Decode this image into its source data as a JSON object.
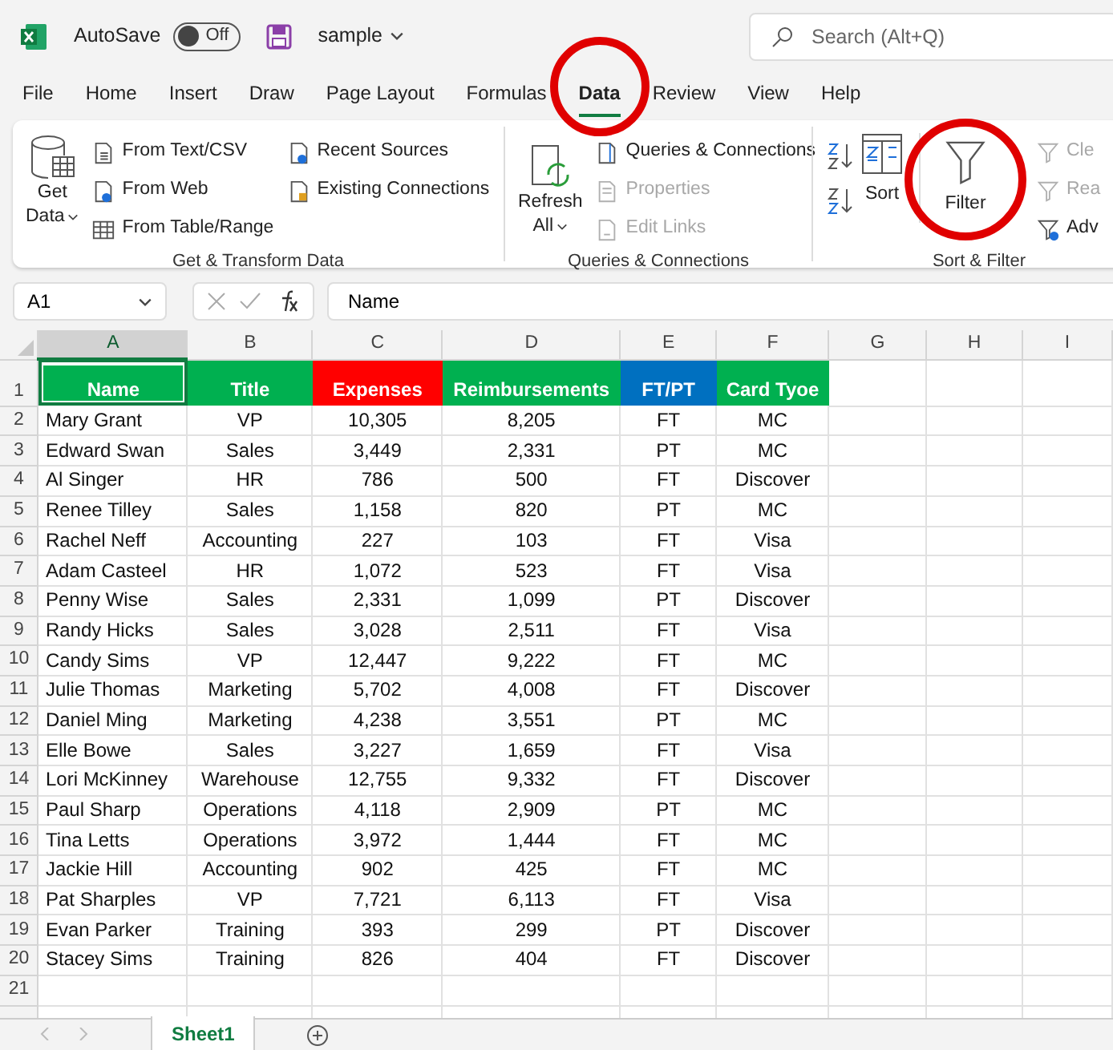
{
  "title_bar": {
    "autosave_label": "AutoSave",
    "autosave": {
      "on": false,
      "label": "Off"
    },
    "filename": "sample",
    "search": {
      "placeholder": "Search (Alt+Q)"
    }
  },
  "menu_tabs": [
    {
      "label": "File",
      "selected": false
    },
    {
      "label": "Home",
      "selected": false
    },
    {
      "label": "Insert",
      "selected": false
    },
    {
      "label": "Draw",
      "selected": false
    },
    {
      "label": "Page Layout",
      "selected": false
    },
    {
      "label": "Formulas",
      "selected": false
    },
    {
      "label": "Data",
      "selected": true
    },
    {
      "label": "Review",
      "selected": false
    },
    {
      "label": "View",
      "selected": false
    },
    {
      "label": "Help",
      "selected": false
    }
  ],
  "ribbon": {
    "groups": [
      {
        "label": "Get & Transform Data",
        "large": {
          "lines": [
            "Get",
            "Data"
          ],
          "kind": "database"
        },
        "columns": [
          [
            {
              "label": "From Text/CSV",
              "kind": "text",
              "disabled": false
            },
            {
              "label": "From Web",
              "kind": "web",
              "disabled": false
            },
            {
              "label": "From Table/Range",
              "kind": "table",
              "disabled": false
            }
          ],
          [
            {
              "label": "Recent Sources",
              "kind": "recent",
              "disabled": false
            },
            {
              "label": "Existing Connections",
              "kind": "connection",
              "disabled": false
            }
          ]
        ]
      },
      {
        "label": "Queries & Connections",
        "large": {
          "lines": [
            "Refresh",
            "All"
          ],
          "kind": "refresh"
        },
        "columns": [
          [
            {
              "label": "Queries & Connections",
              "kind": "queries",
              "disabled": false
            },
            {
              "label": "Properties",
              "kind": "properties",
              "disabled": true
            },
            {
              "label": "Edit Links",
              "kind": "links",
              "disabled": true
            }
          ]
        ]
      },
      {
        "label": "Sort & Filter",
        "sort": {
          "label": "Sort"
        },
        "filter": {
          "label": "Filter"
        },
        "columns": [
          [
            {
              "label": "Cle",
              "kind": "clear",
              "disabled": true
            },
            {
              "label": "Rea",
              "kind": "reapply",
              "disabled": true
            },
            {
              "label": "Adv",
              "kind": "advanced",
              "disabled": false
            }
          ]
        ]
      }
    ]
  },
  "formula_bar": {
    "name_box": "A1",
    "formula": "Name"
  },
  "sheet": {
    "columns": [
      {
        "label": "A",
        "selected": true
      },
      {
        "label": "B",
        "selected": false
      },
      {
        "label": "C",
        "selected": false
      },
      {
        "label": "D",
        "selected": false
      },
      {
        "label": "E",
        "selected": false
      },
      {
        "label": "F",
        "selected": false
      },
      {
        "label": "G",
        "selected": false
      },
      {
        "label": "H",
        "selected": false
      },
      {
        "label": "I",
        "selected": false
      }
    ],
    "header": [
      {
        "text": "Name",
        "color": "#00b050"
      },
      {
        "text": "Title",
        "color": "#00b050"
      },
      {
        "text": "Expenses",
        "color": "#ff0000"
      },
      {
        "text": "Reimbursements",
        "color": "#00b050"
      },
      {
        "text": "FT/PT",
        "color": "#0070c0"
      },
      {
        "text": "Card Tyoe",
        "color": "#00b050"
      }
    ],
    "rows": [
      [
        "Mary Grant",
        "VP",
        "10,305",
        "8,205",
        "FT",
        "MC"
      ],
      [
        "Edward Swan",
        "Sales",
        "3,449",
        "2,331",
        "PT",
        "MC"
      ],
      [
        "Al Singer",
        "HR",
        "786",
        "500",
        "FT",
        "Discover"
      ],
      [
        "Renee Tilley",
        "Sales",
        "1,158",
        "820",
        "PT",
        "MC"
      ],
      [
        "Rachel Neff",
        "Accounting",
        "227",
        "103",
        "FT",
        "Visa"
      ],
      [
        "Adam Casteel",
        "HR",
        "1,072",
        "523",
        "FT",
        "Visa"
      ],
      [
        "Penny Wise",
        "Sales",
        "2,331",
        "1,099",
        "PT",
        "Discover"
      ],
      [
        "Randy Hicks",
        "Sales",
        "3,028",
        "2,511",
        "FT",
        "Visa"
      ],
      [
        "Candy Sims",
        "VP",
        "12,447",
        "9,222",
        "FT",
        "MC"
      ],
      [
        "Julie Thomas",
        "Marketing",
        "5,702",
        "4,008",
        "FT",
        "Discover"
      ],
      [
        "Daniel Ming",
        "Marketing",
        "4,238",
        "3,551",
        "PT",
        "MC"
      ],
      [
        "Elle Bowe",
        "Sales",
        "3,227",
        "1,659",
        "FT",
        "Visa"
      ],
      [
        "Lori McKinney",
        "Warehouse",
        "12,755",
        "9,332",
        "FT",
        "Discover"
      ],
      [
        "Paul Sharp",
        "Operations",
        "4,118",
        "2,909",
        "PT",
        "MC"
      ],
      [
        "Tina Letts",
        "Operations",
        "3,972",
        "1,444",
        "FT",
        "MC"
      ],
      [
        "Jackie Hill",
        "Accounting",
        "902",
        "425",
        "FT",
        "MC"
      ],
      [
        "Pat Sharples",
        "VP",
        "7,721",
        "6,113",
        "FT",
        "Visa"
      ],
      [
        "Evan Parker",
        "Training",
        "393",
        "299",
        "PT",
        "Discover"
      ],
      [
        "Stacey Sims",
        "Training",
        "826",
        "404",
        "FT",
        "Discover"
      ]
    ],
    "row_numbers": [
      "1",
      "2",
      "3",
      "4",
      "5",
      "6",
      "7",
      "8",
      "9",
      "10",
      "11",
      "12",
      "13",
      "14",
      "15",
      "16",
      "17",
      "18",
      "19",
      "20",
      "21"
    ]
  },
  "sheet_tabs": [
    {
      "label": "Sheet1",
      "selected": true
    }
  ]
}
